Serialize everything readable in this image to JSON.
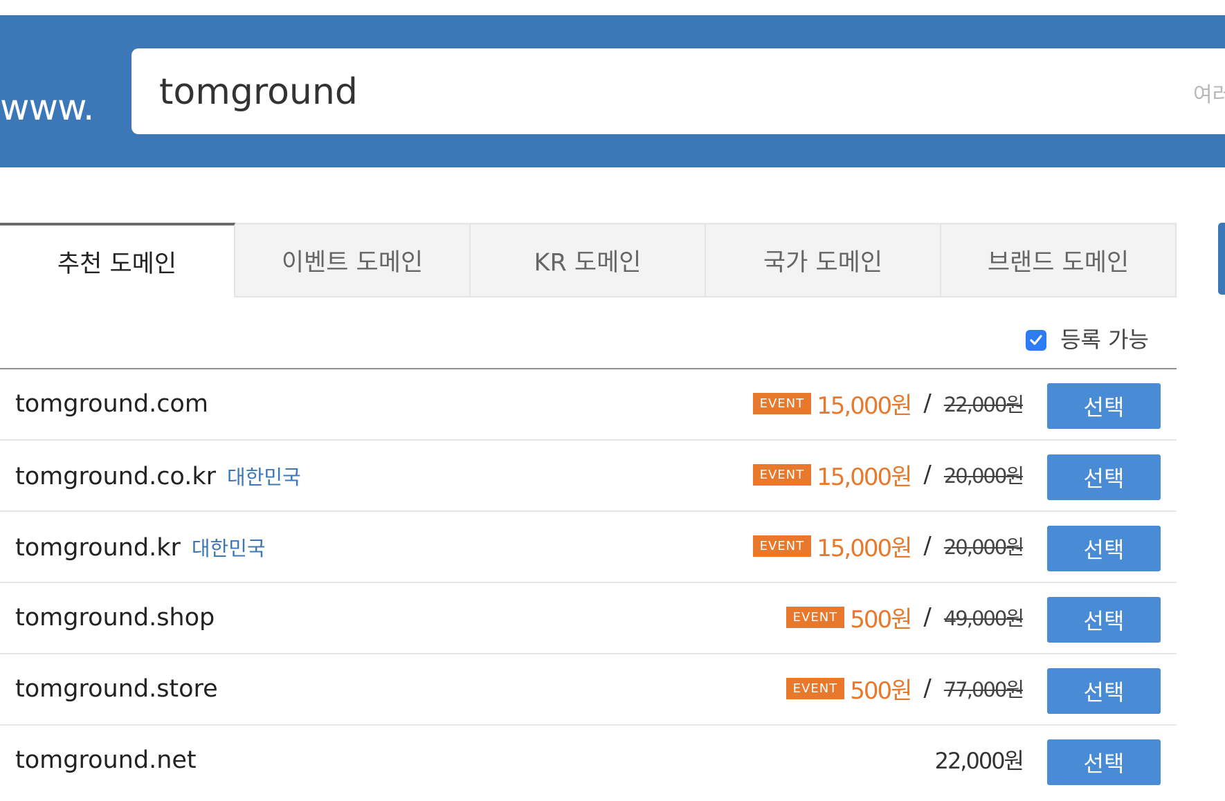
{
  "search": {
    "prefix": "www.",
    "value": "tomground",
    "hint": "여러"
  },
  "tabs": [
    {
      "label": "추천 도메인",
      "active": true
    },
    {
      "label": "이벤트 도메인",
      "active": false
    },
    {
      "label": "KR 도메인",
      "active": false
    },
    {
      "label": "국가 도메인",
      "active": false
    },
    {
      "label": "브랜드 도메인",
      "active": false
    }
  ],
  "filter": {
    "label": "등록 가능",
    "checked": true
  },
  "results": [
    {
      "domain": "tomground.com",
      "country": "",
      "event": "EVENT",
      "price": "15,000원",
      "slash": "/",
      "original_price": "22,000원",
      "button": "선택"
    },
    {
      "domain": "tomground.co.kr",
      "country": "대한민국",
      "event": "EVENT",
      "price": "15,000원",
      "slash": "/",
      "original_price": "20,000원",
      "button": "선택"
    },
    {
      "domain": "tomground.kr",
      "country": "대한민국",
      "event": "EVENT",
      "price": "15,000원",
      "slash": "/",
      "original_price": "20,000원",
      "button": "선택"
    },
    {
      "domain": "tomground.shop",
      "country": "",
      "event": "EVENT",
      "price": "500원",
      "slash": "/",
      "original_price": "49,000원",
      "button": "선택"
    },
    {
      "domain": "tomground.store",
      "country": "",
      "event": "EVENT",
      "price": "500원",
      "slash": "/",
      "original_price": "77,000원",
      "button": "선택"
    },
    {
      "domain": "tomground.net",
      "country": "",
      "event": "",
      "price": "22,000원",
      "slash": "",
      "original_price": "",
      "button": "선택"
    }
  ],
  "colors": {
    "brand_blue": "#3c78b8",
    "button_blue": "#4a8bd6",
    "event_orange": "#e8792c",
    "checkbox_blue": "#2d7cf3"
  }
}
